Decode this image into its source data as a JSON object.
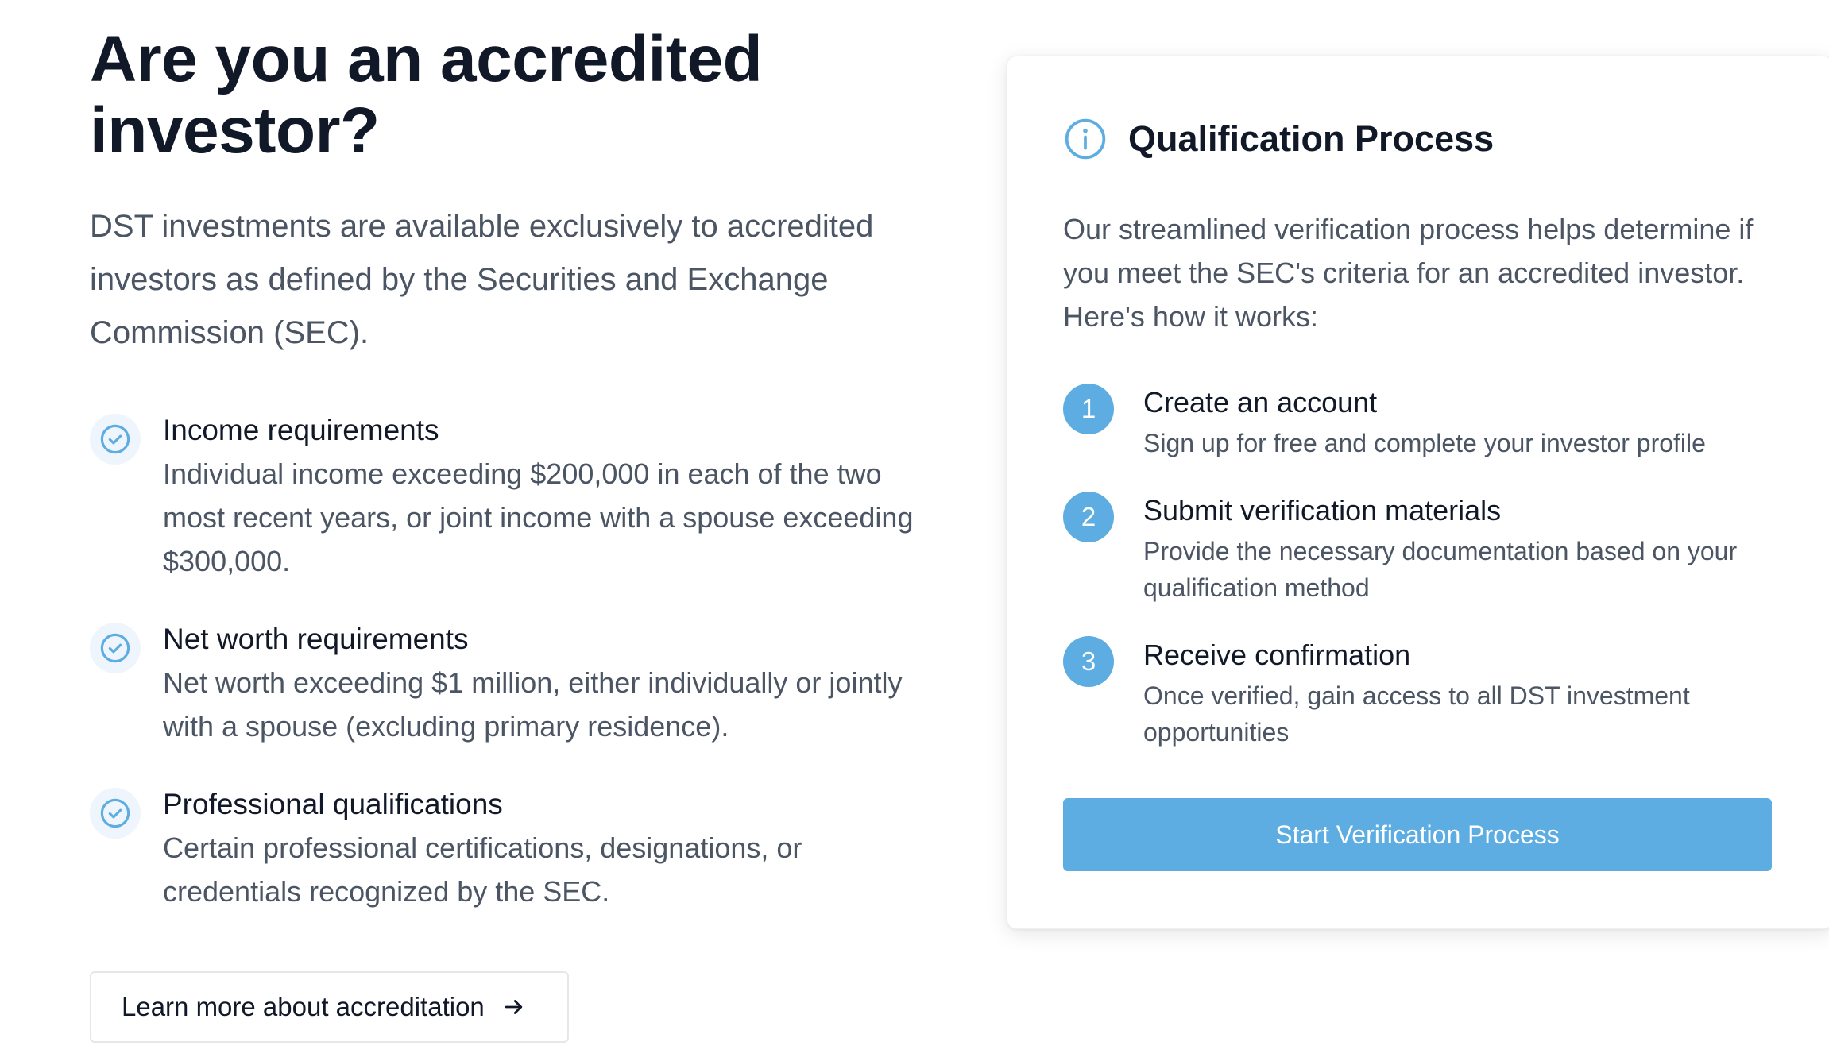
{
  "hero": {
    "title_line1": "Are you an accredited",
    "title_line2": "investor?",
    "intro": "DST investments are available exclusively to accredited investors as defined by the Securities and Exchange Commission (SEC)."
  },
  "requirements": [
    {
      "icon": "check-circle-icon",
      "title": "Income requirements",
      "desc": "Individual income exceeding $200,000 in each of the two most recent years, or joint income with a spouse exceeding $300,000."
    },
    {
      "icon": "check-circle-icon",
      "title": "Net worth requirements",
      "desc": "Net worth exceeding $1 million, either individually or jointly with a spouse (excluding primary residence)."
    },
    {
      "icon": "check-circle-icon",
      "title": "Professional qualifications",
      "desc": "Certain professional certifications, designations, or credentials recognized by the SEC."
    }
  ],
  "learn_more": {
    "label": "Learn more about accreditation",
    "icon": "arrow-right-icon"
  },
  "card": {
    "icon": "info-circle-icon",
    "title": "Qualification Process",
    "intro": "Our streamlined verification process helps determine if you meet the SEC's criteria for an accredited investor. Here's how it works:",
    "steps": [
      {
        "num": "1",
        "title": "Create an account",
        "desc": "Sign up for free and complete your investor profile"
      },
      {
        "num": "2",
        "title": "Submit verification materials",
        "desc": "Provide the necessary documentation based on your qualification method"
      },
      {
        "num": "3",
        "title": "Receive confirmation",
        "desc": "Once verified, gain access to all DST investment opportunities"
      }
    ],
    "button_label": "Start Verification Process"
  },
  "colors": {
    "accent": "#5dade2",
    "heading": "#111827",
    "body": "#4b5563",
    "icon_bg": "#eef5fc"
  }
}
